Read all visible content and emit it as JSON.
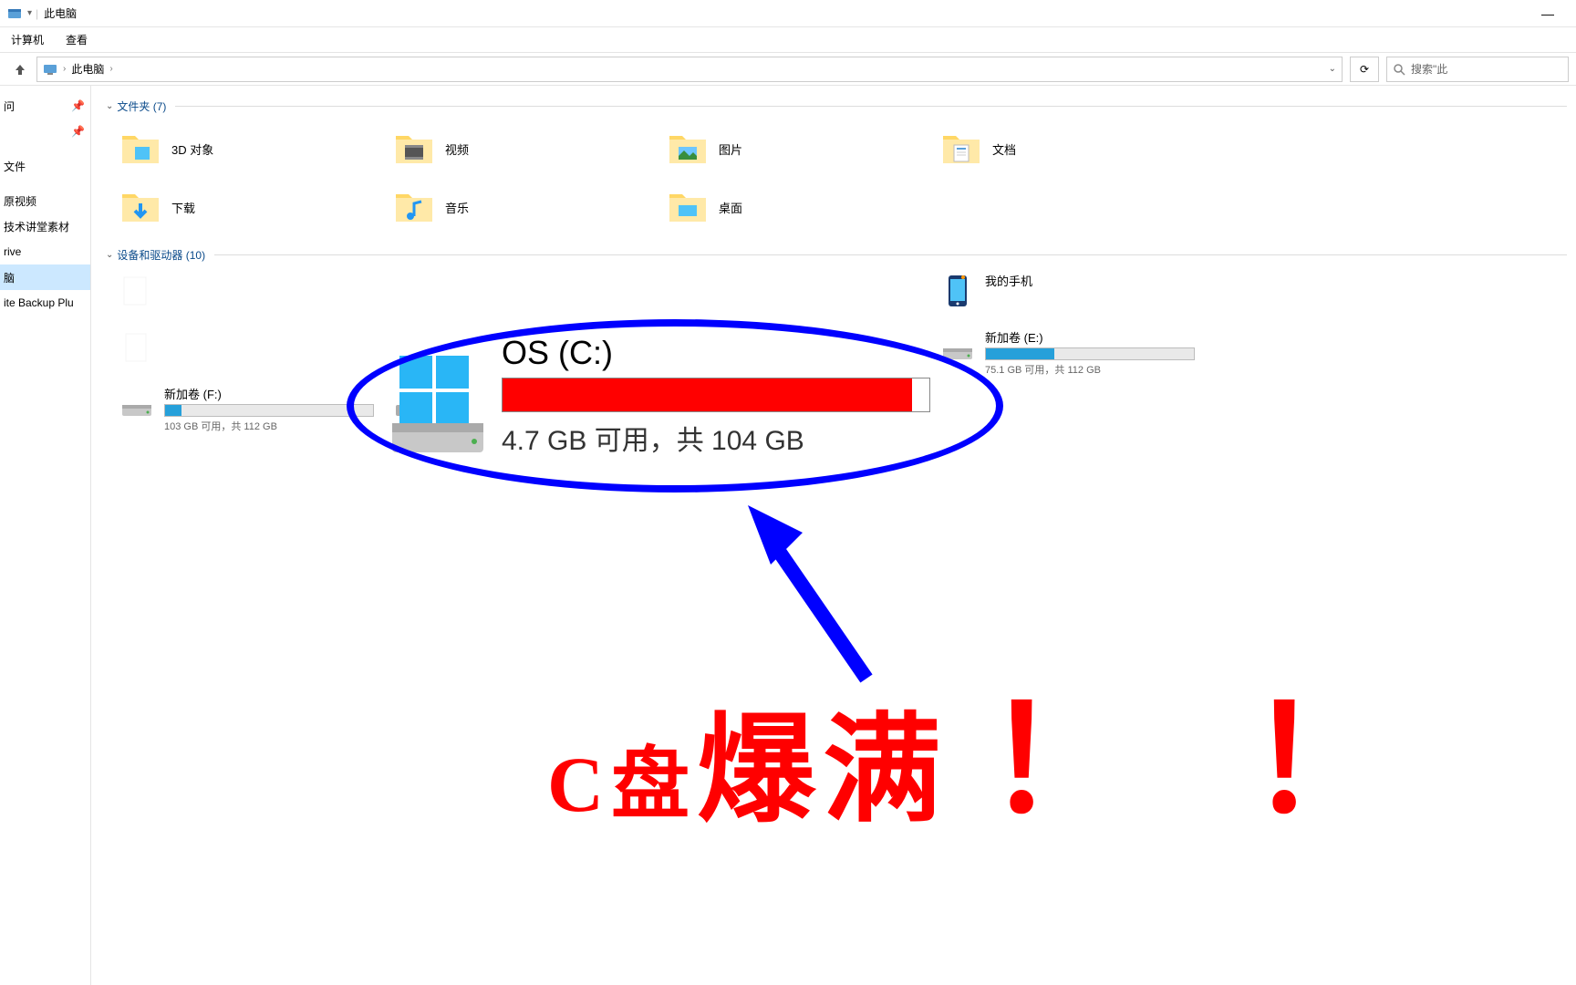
{
  "window": {
    "title": "此电脑",
    "minimize": "—"
  },
  "ribbon": {
    "tab_computer": "计算机",
    "tab_view": "查看"
  },
  "nav": {
    "up_tooltip": "↑"
  },
  "breadcrumb": {
    "root": "此电脑",
    "sep": "›",
    "dropdown": "⌄",
    "refresh": "⟳"
  },
  "search": {
    "placeholder": "搜索\"此"
  },
  "sidebar": {
    "items": [
      {
        "label": "问",
        "pin": true
      },
      {
        "label": "",
        "pin": true
      },
      {
        "label": "文件",
        "pin": false
      },
      {
        "label": "",
        "pin": false
      },
      {
        "label": "原视频",
        "pin": false
      },
      {
        "label": "技术讲堂素材",
        "pin": false
      },
      {
        "label": "rive",
        "pin": false
      },
      {
        "label": "脑",
        "pin": false,
        "selected": true
      },
      {
        "label": "ite Backup Plu",
        "pin": false
      }
    ]
  },
  "sections": {
    "folders_hdr": "文件夹 (7)",
    "drives_hdr": "设备和驱动器 (10)"
  },
  "folders": [
    {
      "label": "3D 对象",
      "icon": "3d"
    },
    {
      "label": "视频",
      "icon": "video"
    },
    {
      "label": "图片",
      "icon": "pictures"
    },
    {
      "label": "文档",
      "icon": "documents"
    },
    {
      "label": "下载",
      "icon": "downloads"
    },
    {
      "label": "音乐",
      "icon": "music"
    },
    {
      "label": "桌面",
      "icon": "desktop"
    }
  ],
  "drives": [
    {
      "name": "",
      "free": "",
      "fill": 0,
      "col": 0,
      "row": 0,
      "icon": "blank"
    },
    {
      "name": "我的手机",
      "free": "",
      "fill": 0,
      "col": 3,
      "row": 0,
      "icon": "phone"
    },
    {
      "name": "新加卷 (E:)",
      "free": "75.1 GB 可用，共 112 GB",
      "fill": 33,
      "col": 3,
      "row": 1,
      "icon": "hdd"
    },
    {
      "name": "新加卷 (F:)",
      "free": "103 GB 可用，共 112 GB",
      "fill": 8,
      "col": 0,
      "row": 2,
      "icon": "hdd"
    }
  ],
  "annotation": {
    "drive_name": "OS (C:)",
    "drive_free": "4.7 GB 可用，共 104 GB",
    "big_text_sm": "C盘",
    "big_text": "爆满",
    "excl": "！"
  }
}
